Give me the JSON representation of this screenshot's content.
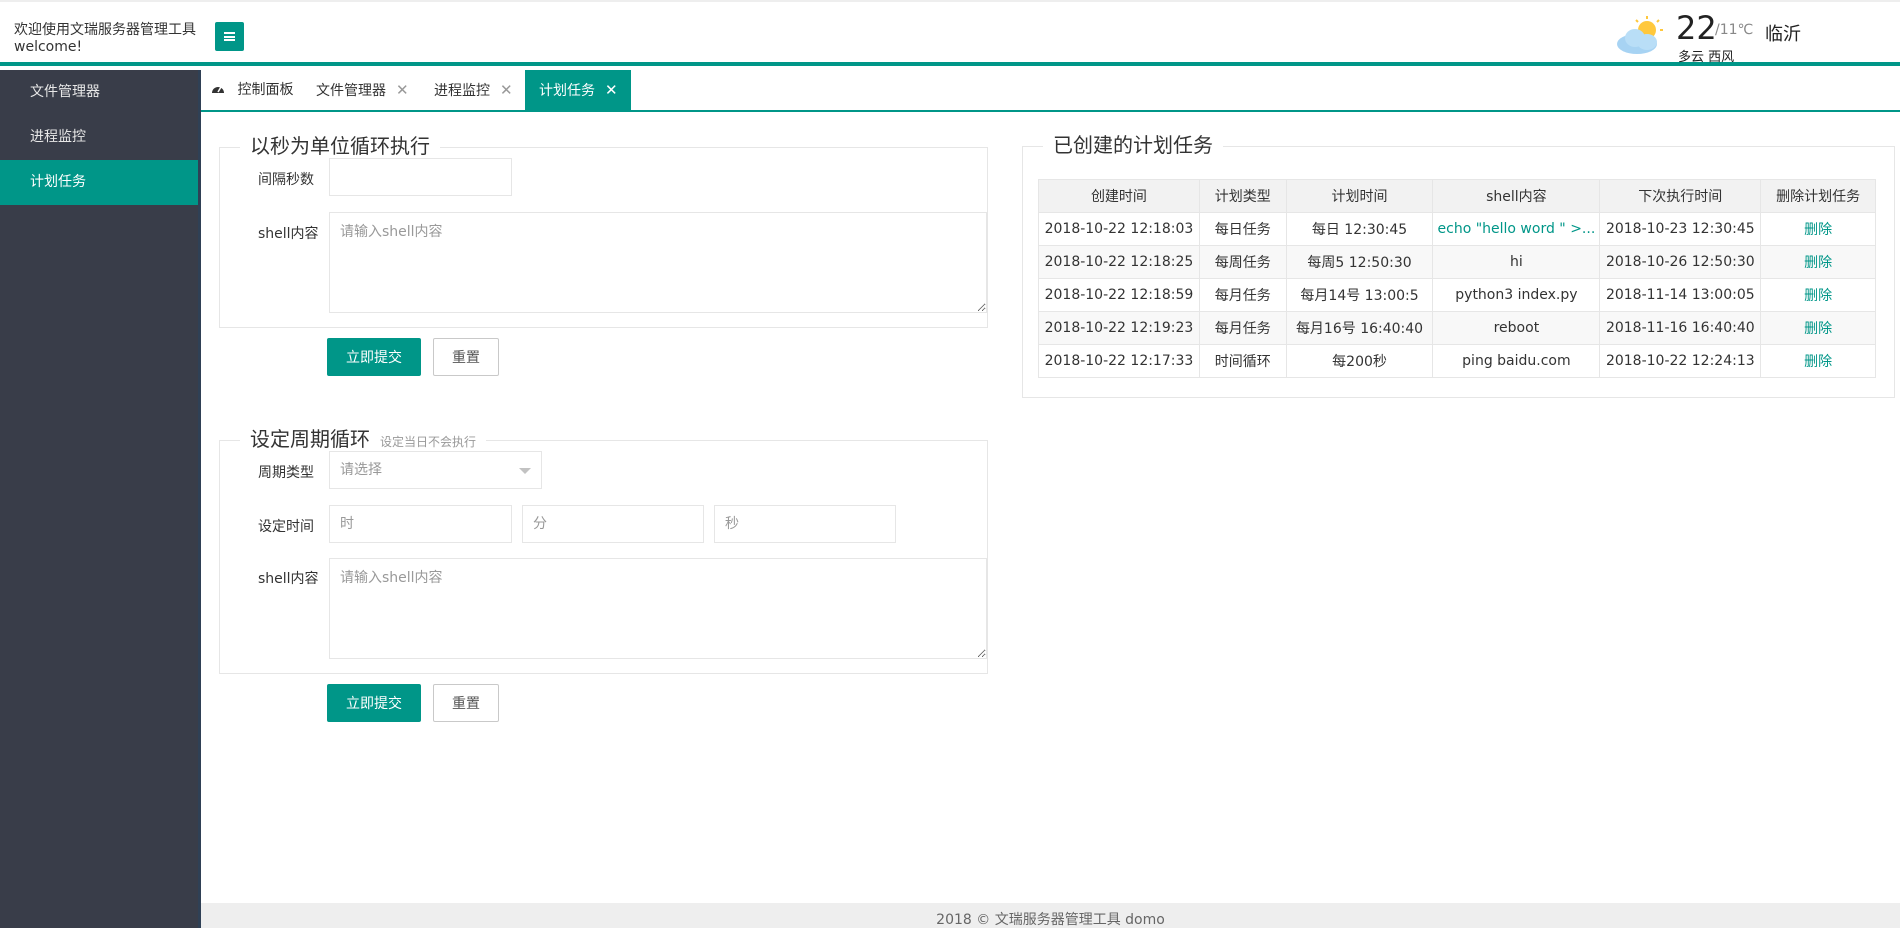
{
  "header": {
    "title_line1": "欢迎使用文瑞服务器管理工具",
    "title_line2": "welcome!",
    "menu_icon": "hamburger-icon"
  },
  "weather": {
    "icon": "partly-cloudy-icon",
    "temp": "22",
    "low": "/11℃",
    "city": "临沂",
    "condition": "多云 西风"
  },
  "sidebar": {
    "items": [
      {
        "label": "文件管理器",
        "active": false
      },
      {
        "label": "进程监控",
        "active": false
      },
      {
        "label": "计划任务",
        "active": true
      }
    ]
  },
  "tabs": [
    {
      "label": "控制面板",
      "icon": "dashboard-icon",
      "closable": false
    },
    {
      "label": "文件管理器",
      "closable": true
    },
    {
      "label": "进程监控",
      "closable": true
    },
    {
      "label": "计划任务",
      "closable": true,
      "active": true
    }
  ],
  "interval_form": {
    "legend": "以秒为单位循环执行",
    "interval_label": "间隔秒数",
    "interval_value": "",
    "shell_label": "shell内容",
    "shell_placeholder": "请输入shell内容",
    "submit": "立即提交",
    "reset": "重置"
  },
  "cycle_form": {
    "legend": "设定周期循环",
    "legend_note": "设定当日不会执行",
    "type_label": "周期类型",
    "type_placeholder": "请选择",
    "time_label": "设定时间",
    "hour_placeholder": "时",
    "minute_placeholder": "分",
    "second_placeholder": "秒",
    "shell_label": "shell内容",
    "shell_placeholder": "请输入shell内容",
    "submit": "立即提交",
    "reset": "重置"
  },
  "tasks": {
    "legend": "已创建的计划任务",
    "columns": [
      "创建时间",
      "计划类型",
      "计划时间",
      "shell内容",
      "下次执行时间",
      "删除计划任务"
    ],
    "rows": [
      {
        "created": "2018-10-22 12:18:03",
        "type": "每日任务",
        "time": "每日 12:30:45",
        "shell": "echo \"hello word \" >...",
        "next": "2018-10-23 12:30:45",
        "action": "删除"
      },
      {
        "created": "2018-10-22 12:18:25",
        "type": "每周任务",
        "time": "每周5 12:50:30",
        "shell": "hi",
        "next": "2018-10-26 12:50:30",
        "action": "删除"
      },
      {
        "created": "2018-10-22 12:18:59",
        "type": "每月任务",
        "time": "每月14号 13:00:5",
        "shell": "python3 index.py",
        "next": "2018-11-14 13:00:05",
        "action": "删除"
      },
      {
        "created": "2018-10-22 12:19:23",
        "type": "每月任务",
        "time": "每月16号 16:40:40",
        "shell": "reboot",
        "next": "2018-11-16 16:40:40",
        "action": "删除"
      },
      {
        "created": "2018-10-22 12:17:33",
        "type": "时间循环",
        "time": "每200秒",
        "shell": "ping baidu.com",
        "next": "2018-10-22 12:24:13",
        "action": "删除"
      }
    ]
  },
  "footer": {
    "text": "2018 ©  文瑞服务器管理工具  domo"
  },
  "colors": {
    "accent": "#009688",
    "sidebar_bg": "#393d49"
  }
}
